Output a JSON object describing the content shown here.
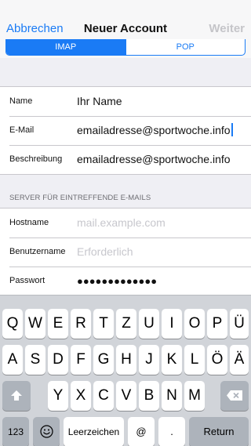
{
  "nav": {
    "cancel": "Abbrechen",
    "title": "Neuer Account",
    "next": "Weiter"
  },
  "segments": {
    "imap": "IMAP",
    "pop": "POP",
    "selected": "IMAP"
  },
  "account": {
    "rows": [
      {
        "label": "Name",
        "value": "Ihr Name"
      },
      {
        "label": "E-Mail",
        "value": "emailadresse@sportwoche.info"
      },
      {
        "label": "Beschreibung",
        "value": "emailadresse@sportwoche.info"
      }
    ]
  },
  "incoming": {
    "header": "SERVER FÜR EINTREFFENDE E-MAILS",
    "hostname": {
      "label": "Hostname",
      "placeholder": "mail.example.com"
    },
    "username": {
      "label": "Benutzername",
      "placeholder": "Erforderlich"
    },
    "password": {
      "label": "Passwort",
      "value": "●●●●●●●●●●●●●"
    }
  },
  "keyboard": {
    "row1": [
      "Q",
      "W",
      "E",
      "R",
      "T",
      "Z",
      "U",
      "I",
      "O",
      "P",
      "Ü"
    ],
    "row2": [
      "A",
      "S",
      "D",
      "F",
      "G",
      "H",
      "J",
      "K",
      "L",
      "Ö",
      "Ä"
    ],
    "row3": [
      "Y",
      "X",
      "C",
      "V",
      "B",
      "N",
      "M"
    ],
    "shift_icon": "shift-icon",
    "delete_icon": "delete-icon",
    "numbers": "123",
    "emoji_icon": "emoji-icon",
    "space": "Leerzeichen",
    "at": "@",
    "dot": ".",
    "return": "Return"
  },
  "colors": {
    "accent": "#1a7bf5",
    "disabled": "#c5c5c9",
    "keyboard_bg": "#d1d4d9"
  }
}
